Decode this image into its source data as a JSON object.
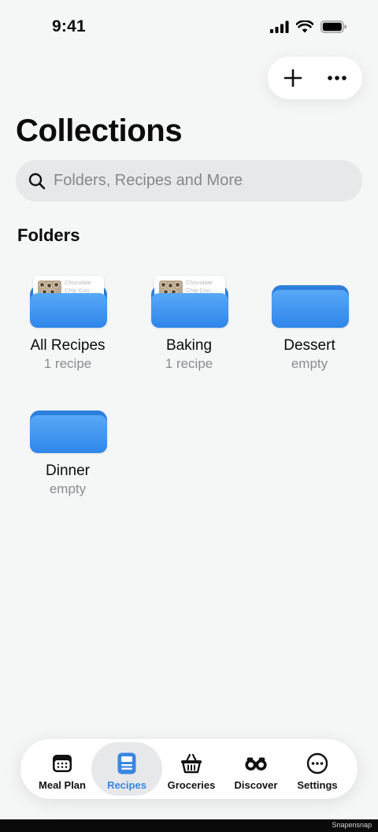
{
  "status_bar": {
    "time": "9:41"
  },
  "toolbar": {
    "add_icon": "plus-icon",
    "more_icon": "ellipsis-icon"
  },
  "page": {
    "title": "Collections"
  },
  "search": {
    "placeholder": "Folders, Recipes and More",
    "value": ""
  },
  "folders_section": {
    "title": "Folders",
    "items": [
      {
        "name": "All Recipes",
        "count": "1 recipe",
        "preview_text": "Chocolate Chip Coo..."
      },
      {
        "name": "Baking",
        "count": "1 recipe",
        "preview_text": "Chocolate Chip Coo..."
      },
      {
        "name": "Dessert",
        "count": "empty"
      },
      {
        "name": "Dinner",
        "count": "empty"
      }
    ]
  },
  "tab_bar": {
    "items": [
      {
        "label": "Meal Plan",
        "icon": "calendar-icon"
      },
      {
        "label": "Recipes",
        "icon": "recipe-card-icon",
        "active": true
      },
      {
        "label": "Groceries",
        "icon": "basket-icon"
      },
      {
        "label": "Discover",
        "icon": "binoculars-icon"
      },
      {
        "label": "Settings",
        "icon": "ellipsis-circle-icon"
      }
    ]
  },
  "colors": {
    "accent": "#3a86e0",
    "folder_blue": "#2f86ea",
    "background": "#f5f6f6"
  },
  "watermark": "Snapensnap"
}
